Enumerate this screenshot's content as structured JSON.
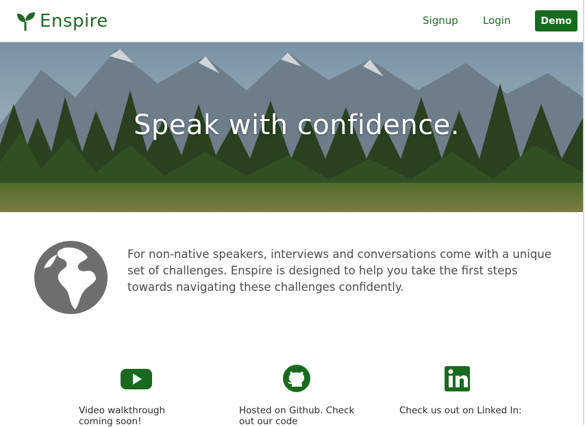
{
  "header": {
    "brand": "Enspire",
    "nav": {
      "signup": "Signup",
      "login": "Login",
      "demo": "Demo"
    }
  },
  "hero": {
    "title": "Speak with confidence."
  },
  "intro": {
    "text": "For non-native speakers, interviews and conversations come with a unique set of challenges. Enspire is designed to help you take the first steps towards navigating these challenges confidently."
  },
  "cards": [
    {
      "icon": "youtube-icon",
      "text": "Video walkthrough coming soon!"
    },
    {
      "icon": "github-icon",
      "text": "Hosted on Github. Check out our code"
    },
    {
      "icon": "linkedin-icon",
      "text": "Check us out on Linked In:"
    }
  ],
  "colors": {
    "brand_green": "#1f6a24",
    "demo_bg": "#176a1e",
    "globe_gray": "#6e6e6e"
  }
}
